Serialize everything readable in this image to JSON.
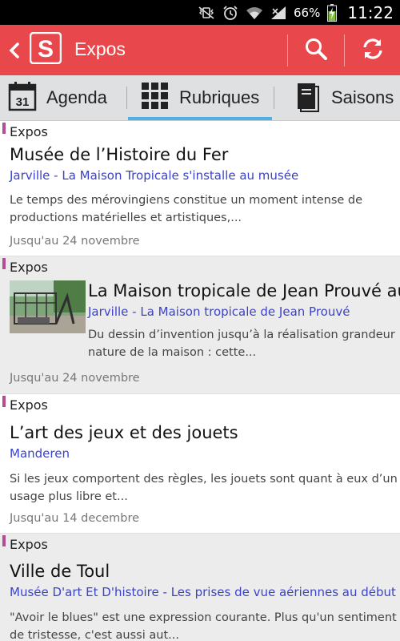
{
  "status_bar": {
    "battery_percent": "66%",
    "time": "11:22",
    "icons": [
      "mute-vibrate-icon",
      "alarm-icon",
      "wifi-icon",
      "signal-icon",
      "battery-charging-icon"
    ]
  },
  "action_bar": {
    "title": "Expos",
    "logo_letter": "S",
    "accent_color": "#e8474b"
  },
  "tabs": [
    {
      "label": "Agenda",
      "icon": "calendar-icon",
      "calendar_day": "31",
      "selected": false
    },
    {
      "label": "Rubriques",
      "icon": "grid-icon",
      "selected": true
    },
    {
      "label": "Saisons",
      "icon": "book-icon",
      "selected": false
    }
  ],
  "items": [
    {
      "category": "Expos",
      "title": "Musée de l’Histoire du Fer",
      "subtitle": "Jarville - La Maison Tropicale s'installe au musée",
      "desc1": "Le temps des mérovingiens constitue un moment intense de",
      "desc2": "productions matérielles et artistiques,...",
      "date": "Jusqu'au 24 novembre"
    },
    {
      "category": "Expos",
      "title": "La Maison tropicale de Jean Prouvé au",
      "subtitle": "Jarville - La Maison tropicale de Jean Prouvé",
      "desc1": "Du dessin d’invention jusqu’à la réalisation grandeur",
      "desc2": "nature de la maison : cette...",
      "date": "Jusqu'au 24 novembre"
    },
    {
      "category": "Expos",
      "title": "L’art des jeux et des jouets",
      "subtitle": "Manderen",
      "desc1": "Si les jeux comportent des règles, les jouets sont quant à eux d’un",
      "desc2": "usage plus libre et...",
      "date": "Jusqu'au 14 decembre"
    },
    {
      "category": "Expos",
      "title": "Ville de Toul",
      "subtitle": "Musée D'art Et D'histoire - Les prises de vue aériennes au début de",
      "desc1": "\"Avoir le blues\" est une expression courante. Plus qu'un sentiment",
      "desc2": "de tristesse, c'est aussi aut..."
    }
  ]
}
